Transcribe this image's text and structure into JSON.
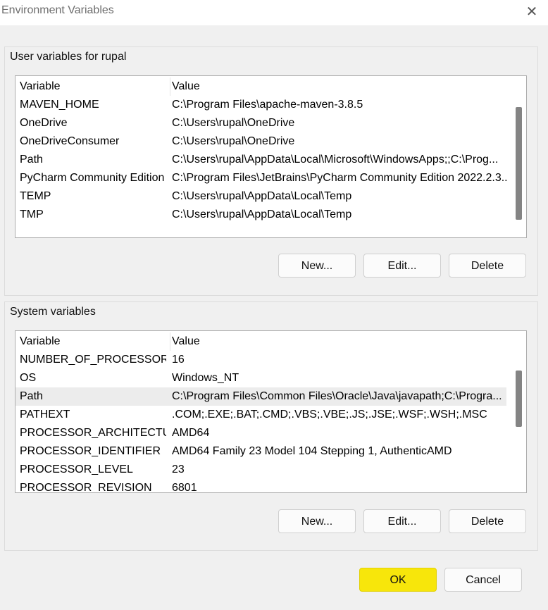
{
  "window": {
    "title": "Environment Variables"
  },
  "user_section": {
    "label": "User variables for rupal",
    "columns": [
      "Variable",
      "Value"
    ],
    "rows": [
      {
        "variable": "MAVEN_HOME",
        "value": "C:\\Program Files\\apache-maven-3.8.5"
      },
      {
        "variable": "OneDrive",
        "value": "C:\\Users\\rupal\\OneDrive"
      },
      {
        "variable": "OneDriveConsumer",
        "value": "C:\\Users\\rupal\\OneDrive"
      },
      {
        "variable": "Path",
        "value": "C:\\Users\\rupal\\AppData\\Local\\Microsoft\\WindowsApps;;C:\\Prog..."
      },
      {
        "variable": "PyCharm Community Edition",
        "value": "C:\\Program Files\\JetBrains\\PyCharm Community Edition 2022.2.3..."
      },
      {
        "variable": "TEMP",
        "value": "C:\\Users\\rupal\\AppData\\Local\\Temp"
      },
      {
        "variable": "TMP",
        "value": "C:\\Users\\rupal\\AppData\\Local\\Temp"
      }
    ],
    "buttons": {
      "new": "New...",
      "edit": "Edit...",
      "delete": "Delete"
    }
  },
  "system_section": {
    "label": "System variables",
    "columns": [
      "Variable",
      "Value"
    ],
    "rows": [
      {
        "variable": "NUMBER_OF_PROCESSORS",
        "value": "16"
      },
      {
        "variable": "OS",
        "value": "Windows_NT"
      },
      {
        "variable": "Path",
        "value": "C:\\Program Files\\Common Files\\Oracle\\Java\\javapath;C:\\Progra..."
      },
      {
        "variable": "PATHEXT",
        "value": ".COM;.EXE;.BAT;.CMD;.VBS;.VBE;.JS;.JSE;.WSF;.WSH;.MSC"
      },
      {
        "variable": "PROCESSOR_ARCHITECTURE",
        "value": "AMD64"
      },
      {
        "variable": "PROCESSOR_IDENTIFIER",
        "value": "AMD64 Family 23 Model 104 Stepping 1, AuthenticAMD"
      },
      {
        "variable": "PROCESSOR_LEVEL",
        "value": "23"
      },
      {
        "variable": "PROCESSOR_REVISION",
        "value": "6801"
      }
    ],
    "selected_variable": "Path",
    "buttons": {
      "new": "New...",
      "edit": "Edit...",
      "delete": "Delete"
    }
  },
  "footer": {
    "ok": "OK",
    "cancel": "Cancel"
  },
  "icons": {
    "close": "close-icon"
  },
  "colors": {
    "ok_button": "#f7e60b",
    "selected_row": "#ececec"
  }
}
